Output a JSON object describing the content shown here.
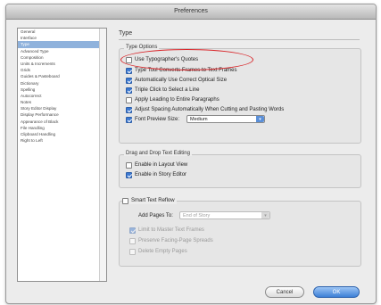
{
  "window": {
    "title": "Preferences"
  },
  "sidebar": {
    "items": [
      {
        "label": "General",
        "selected": false
      },
      {
        "label": "Interface",
        "selected": false
      },
      {
        "label": "Type",
        "selected": true
      },
      {
        "label": "Advanced Type",
        "selected": false
      },
      {
        "label": "Composition",
        "selected": false
      },
      {
        "label": "Units & Increments",
        "selected": false
      },
      {
        "label": "Grids",
        "selected": false
      },
      {
        "label": "Guides & Pasteboard",
        "selected": false
      },
      {
        "label": "Dictionary",
        "selected": false
      },
      {
        "label": "Spelling",
        "selected": false
      },
      {
        "label": "Autocorrect",
        "selected": false
      },
      {
        "label": "Notes",
        "selected": false
      },
      {
        "label": "Story Editor Display",
        "selected": false
      },
      {
        "label": "Display Performance",
        "selected": false
      },
      {
        "label": "Appearance of Black",
        "selected": false
      },
      {
        "label": "File Handling",
        "selected": false
      },
      {
        "label": "Clipboard Handling",
        "selected": false
      },
      {
        "label": "Right to Left",
        "selected": false
      }
    ]
  },
  "main": {
    "section_title": "Type",
    "type_options": {
      "label": "Type Options",
      "items": [
        {
          "label": "Use Typographer's Quotes",
          "checked": false,
          "enabled": true
        },
        {
          "label": "Type Tool Converts Frames to Text Frames",
          "checked": true,
          "enabled": true
        },
        {
          "label": "Automatically Use Correct Optical Size",
          "checked": true,
          "enabled": true
        },
        {
          "label": "Triple Click to Select a Line",
          "checked": true,
          "enabled": true
        },
        {
          "label": "Apply Leading to Entire Paragraphs",
          "checked": false,
          "enabled": true
        },
        {
          "label": "Adjust Spacing Automatically When Cutting and Pasting Words",
          "checked": true,
          "enabled": true
        }
      ],
      "font_preview": {
        "label": "Font Preview Size:",
        "checked": true,
        "value": "Medium"
      }
    },
    "drag_drop": {
      "label": "Drag and Drop Text Editing",
      "items": [
        {
          "label": "Enable in Layout View",
          "checked": false,
          "enabled": true
        },
        {
          "label": "Enable in Story Editor",
          "checked": true,
          "enabled": true
        }
      ]
    },
    "smart_reflow": {
      "label": "Smart Text Reflow",
      "checked": false,
      "add_pages_label": "Add Pages To:",
      "add_pages_value": "End of Story",
      "items": [
        {
          "label": "Limit to Master Text Frames",
          "checked": true,
          "enabled": false
        },
        {
          "label": "Preserve Facing-Page Spreads",
          "checked": false,
          "enabled": false
        },
        {
          "label": "Delete Empty Pages",
          "checked": false,
          "enabled": false
        }
      ]
    }
  },
  "buttons": {
    "cancel": "Cancel",
    "ok": "OK"
  },
  "colors": {
    "accent": "#3b78d1",
    "highlight_ring": "#d9262a",
    "selection": "#8fb2dc"
  }
}
